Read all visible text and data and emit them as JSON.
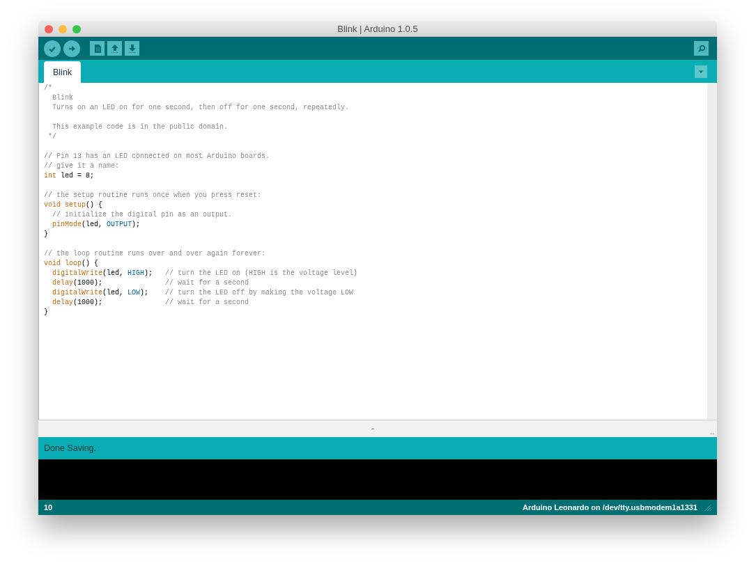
{
  "window": {
    "title": "Blink | Arduino 1.0.5"
  },
  "toolbar": {
    "buttons": [
      {
        "kind": "verify"
      },
      {
        "kind": "upload"
      },
      {
        "kind": "new"
      },
      {
        "kind": "open"
      },
      {
        "kind": "save"
      }
    ],
    "right_button": {
      "kind": "serial"
    }
  },
  "tabs": [
    {
      "label": "Blink",
      "selected": true
    }
  ],
  "editor": {
    "blocks": [
      {
        "lines": [
          [
            {
              "kind": "comment",
              "text": "/*"
            }
          ],
          [
            {
              "kind": "comment",
              "text": "  Blink"
            }
          ],
          [
            {
              "kind": "comment",
              "text": "  Turns on an LED on for one second, then off for one second, repeatedly."
            }
          ]
        ]
      },
      {
        "lines": [
          [
            {
              "kind": "comment",
              "text": "  This example code is in the public domain."
            }
          ],
          [
            {
              "kind": "comment",
              "text": " */"
            }
          ]
        ]
      },
      {
        "lines": [
          [
            {
              "kind": "comment",
              "text": "// Pin 13 has an LED connected on most Arduino boards."
            }
          ],
          [
            {
              "kind": "comment",
              "text": "// give it a name:"
            }
          ],
          [
            {
              "kind": "keyword",
              "text": "int"
            },
            {
              "kind": "plain",
              "text": " led = 8;"
            }
          ]
        ]
      },
      {
        "lines": [
          [
            {
              "kind": "comment",
              "text": "// the setup routine runs once when you press reset:"
            }
          ],
          [
            {
              "kind": "keyword",
              "text": "void setup"
            },
            {
              "kind": "plain",
              "text": "() {"
            }
          ],
          [
            {
              "kind": "comment",
              "text": "  // initialize the digital pin as an output."
            }
          ],
          [
            {
              "kind": "keyword",
              "text": "  pinMode"
            },
            {
              "kind": "plain",
              "text": "(led, "
            },
            {
              "kind": "constant",
              "text": "OUTPUT"
            },
            {
              "kind": "plain",
              "text": ");"
            }
          ],
          [
            {
              "kind": "plain",
              "text": "}"
            }
          ]
        ]
      },
      {
        "lines": [
          [
            {
              "kind": "comment",
              "text": "// the loop routine runs over and over again forever:"
            }
          ],
          [
            {
              "kind": "keyword",
              "text": "void loop"
            },
            {
              "kind": "plain",
              "text": "() {"
            }
          ],
          [
            {
              "kind": "keyword",
              "text": "  digitalWrite"
            },
            {
              "kind": "plain",
              "text": "(led, "
            },
            {
              "kind": "constant",
              "text": "HIGH"
            },
            {
              "kind": "plain",
              "text": ");   "
            },
            {
              "kind": "comment",
              "text": "// turn the LED on (HIGH is the voltage level)"
            }
          ],
          [
            {
              "kind": "keyword",
              "text": "  delay"
            },
            {
              "kind": "plain",
              "text": "(1000);               "
            },
            {
              "kind": "comment",
              "text": "// wait for a second"
            }
          ],
          [
            {
              "kind": "keyword",
              "text": "  digitalWrite"
            },
            {
              "kind": "plain",
              "text": "(led, "
            },
            {
              "kind": "constant",
              "text": "LOW"
            },
            {
              "kind": "plain",
              "text": ");    "
            },
            {
              "kind": "comment",
              "text": "// turn the LED off by making the voltage LOW"
            }
          ],
          [
            {
              "kind": "keyword",
              "text": "  delay"
            },
            {
              "kind": "plain",
              "text": "(1000);               "
            },
            {
              "kind": "comment",
              "text": "// wait for a second"
            }
          ],
          [
            {
              "kind": "plain",
              "text": "}"
            }
          ]
        ]
      }
    ]
  },
  "status": {
    "message": "Done Saving."
  },
  "footer": {
    "line": "10",
    "board": "Arduino Leonardo on /dev/tty.usbmodem1a1331"
  }
}
